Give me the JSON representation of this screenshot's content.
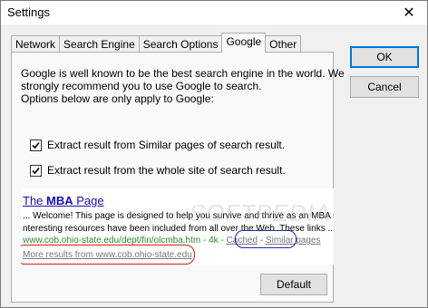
{
  "window": {
    "title": "Settings",
    "close_glyph": "✕"
  },
  "tabs": [
    {
      "label": "Network",
      "active": false
    },
    {
      "label": "Search Engine",
      "active": false
    },
    {
      "label": "Search Options",
      "active": false
    },
    {
      "label": "Google",
      "active": true
    },
    {
      "label": "Other",
      "active": false
    }
  ],
  "intro": {
    "line1": "Google is well known to be the best search engine in the world. We",
    "line2": "strongly recommend you to use Google to search.",
    "line3": "Options below are only apply to Google:"
  },
  "options": [
    {
      "label": "Extract result from Similar pages of search result.",
      "checked": true
    },
    {
      "label": "Extract result from the whole site of search result.",
      "checked": true
    }
  ],
  "preview": {
    "title_prefix": "The ",
    "title_bold": "MBA",
    "title_suffix": " Page",
    "desc_line1": "... Welcome! This page is designed to help you survive and thrive as an MBA student.",
    "desc_line2": "nteresting resources have been included from all over the Web. These links ...",
    "url": "www.cob.ohio-state.edu/dept/fin/olcmba.htm - 4k - ",
    "cached": "Cached",
    "sep": " - ",
    "similar": "Similar pages",
    "more_results": "More results from www.cob.ohio-state.edu",
    "watermark": "SOFTPEDIA"
  },
  "buttons": {
    "ok": "OK",
    "cancel": "Cancel",
    "default": "Default"
  },
  "colors": {
    "link": "#1a0dab",
    "url_green": "#2e8b2e",
    "similar_oval": "#1c2fa0",
    "more_oval": "#d21d1d",
    "focus": "#0078d7"
  }
}
